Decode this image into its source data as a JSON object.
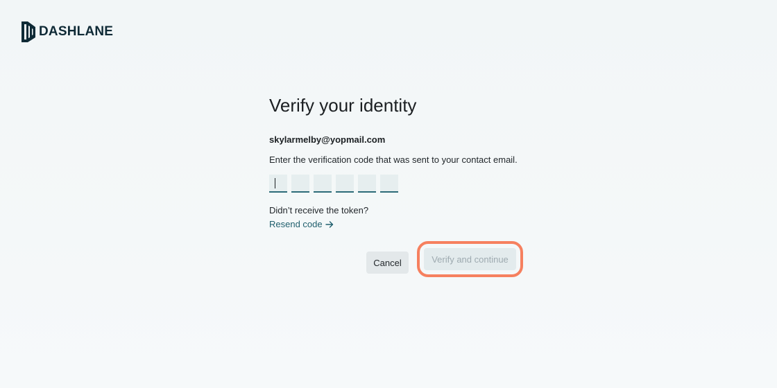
{
  "brand": {
    "name": "DASHLANE",
    "icon": "dashlane-logo-icon",
    "color": "#0f2a36"
  },
  "page": {
    "title": "Verify your identity",
    "email": "skylarmelby@yopmail.com",
    "instructions": "Enter the verification code that was sent to your contact email.",
    "code_fields": [
      "",
      "",
      "",
      "",
      "",
      ""
    ],
    "resend_question": "Didn’t receive the token?",
    "resend_label": "Resend code",
    "resend_icon": "arrow-right-icon"
  },
  "actions": {
    "cancel_label": "Cancel",
    "verify_label": "Verify and continue"
  },
  "colors": {
    "link": "#1f5f6d",
    "highlight": "#f6805f",
    "disabled_text": "#9eaab0"
  }
}
